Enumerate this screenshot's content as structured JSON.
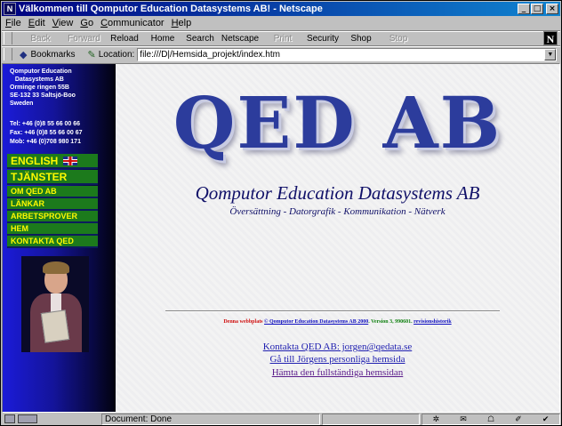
{
  "window": {
    "title": "Välkommen till Qomputor Education Datasystems AB! - Netscape",
    "controls": {
      "minimize": "_",
      "maximize": "□",
      "close": "×"
    }
  },
  "menubar": [
    "File",
    "Edit",
    "View",
    "Go",
    "Communicator",
    "Help"
  ],
  "navbar": [
    {
      "label": "Back",
      "enabled": false
    },
    {
      "label": "Forward",
      "enabled": false
    },
    {
      "label": "Reload",
      "enabled": true
    },
    {
      "label": "Home",
      "enabled": true
    },
    {
      "label": "Search",
      "enabled": true
    },
    {
      "label": "Netscape",
      "enabled": true
    },
    {
      "label": "Print",
      "enabled": false
    },
    {
      "label": "Security",
      "enabled": true
    },
    {
      "label": "Shop",
      "enabled": true
    },
    {
      "label": "Stop",
      "enabled": false
    }
  ],
  "brand_logo": "N",
  "location": {
    "bookmarks_label": "Bookmarks",
    "location_label": "Location:",
    "url": "file:///D|/Hemsida_projekt/index.htm"
  },
  "sidebar": {
    "address": [
      "Qomputor Education",
      "   Datasystems AB",
      "Orminge ringen 55B",
      "SE-132 33 Saltsjö-Boo",
      "Sweden"
    ],
    "contact": [
      "Tel: +46 (0)8 55 66 00 66",
      "Fax: +46 (0)8 55 66 00 67",
      "Mob: +46 (0)708 980 171"
    ],
    "menu": [
      {
        "label": "ENGLISH",
        "size": "big",
        "flag": true
      },
      {
        "label": "TJÄNSTER",
        "size": "big",
        "flag": false
      },
      {
        "label": "OM QED AB",
        "size": "small",
        "flag": false
      },
      {
        "label": "LÄNKAR",
        "size": "small",
        "flag": false
      },
      {
        "label": "ARBETSPROVER",
        "size": "small",
        "flag": false
      },
      {
        "label": "HEM",
        "size": "small",
        "flag": false
      },
      {
        "label": "KONTAKTA QED",
        "size": "small",
        "flag": false
      }
    ]
  },
  "main": {
    "logo": "QED AB",
    "company": "Qomputor Education Datasystems AB",
    "tagline": "Översättning - Datorgrafik - Kommunikation - Nätverk",
    "fineprint": {
      "prefix": "Denna webbplats",
      "copyright": "© Qomputor Education Datasystems AB 2000",
      "version": ". Version 3, 990601.",
      "history": "revisionshistorik"
    },
    "links": [
      "Kontakta QED AB: jorgen@qedata.se",
      "Gå till Jörgens personliga hemsida",
      "Hämta den fullständiga hemsidan"
    ]
  },
  "status": {
    "text": "Document: Done"
  }
}
